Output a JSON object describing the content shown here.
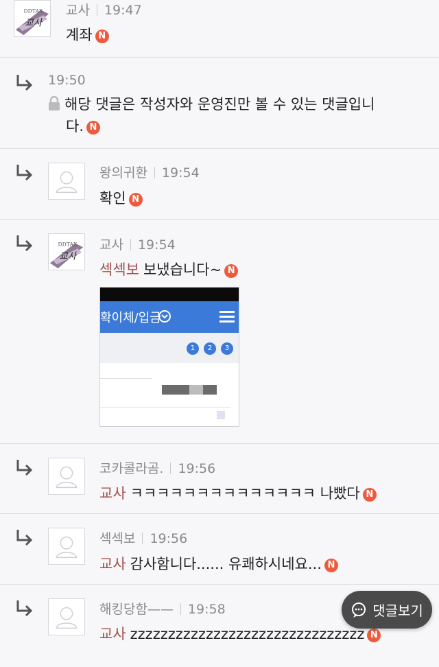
{
  "comments": [
    {
      "author": "교사",
      "time": "19:47",
      "text": "계좌",
      "badge": "N"
    },
    {
      "time": "19:50",
      "text_line1": "해당 댓글은 작성자와 운영진만 볼 수 있는 댓글입니",
      "text_line2": "다.",
      "badge": "N"
    },
    {
      "author": "왕의귀환",
      "time": "19:54",
      "text": "확인",
      "badge": "N"
    },
    {
      "author": "교사",
      "time": "19:54",
      "mention": "섹섹보",
      "text": "보냈습니다~",
      "badge": "N"
    },
    {
      "author": "코카콜라곰.",
      "time": "19:56",
      "mention": "교사",
      "text": "ㅋㅋㅋㅋㅋㅋㅋㅋㅋㅋㅋㅋㅋㅋ 나빴다",
      "badge": "N"
    },
    {
      "author": "섹섹보",
      "time": "19:56",
      "mention": "교사",
      "text": "감사함니다...... 유쾌하시네요...",
      "badge": "N"
    },
    {
      "author": "해킹당함——",
      "time": "19:58",
      "mention": "교사",
      "text": "zzzzzzzzzzzzzzzzzzzzzzzzzzzzzzz",
      "badge": "N"
    }
  ],
  "attachment": {
    "blue_text": "확이체/입금",
    "page_numbers": [
      "1",
      "2",
      "3"
    ]
  },
  "float_button": {
    "label": "댓글보기"
  },
  "colors": {
    "badge": "#ef5a3c",
    "mention": "#a0504a",
    "accent_blue": "#3b7ad8",
    "button": "#4a4a4a"
  }
}
